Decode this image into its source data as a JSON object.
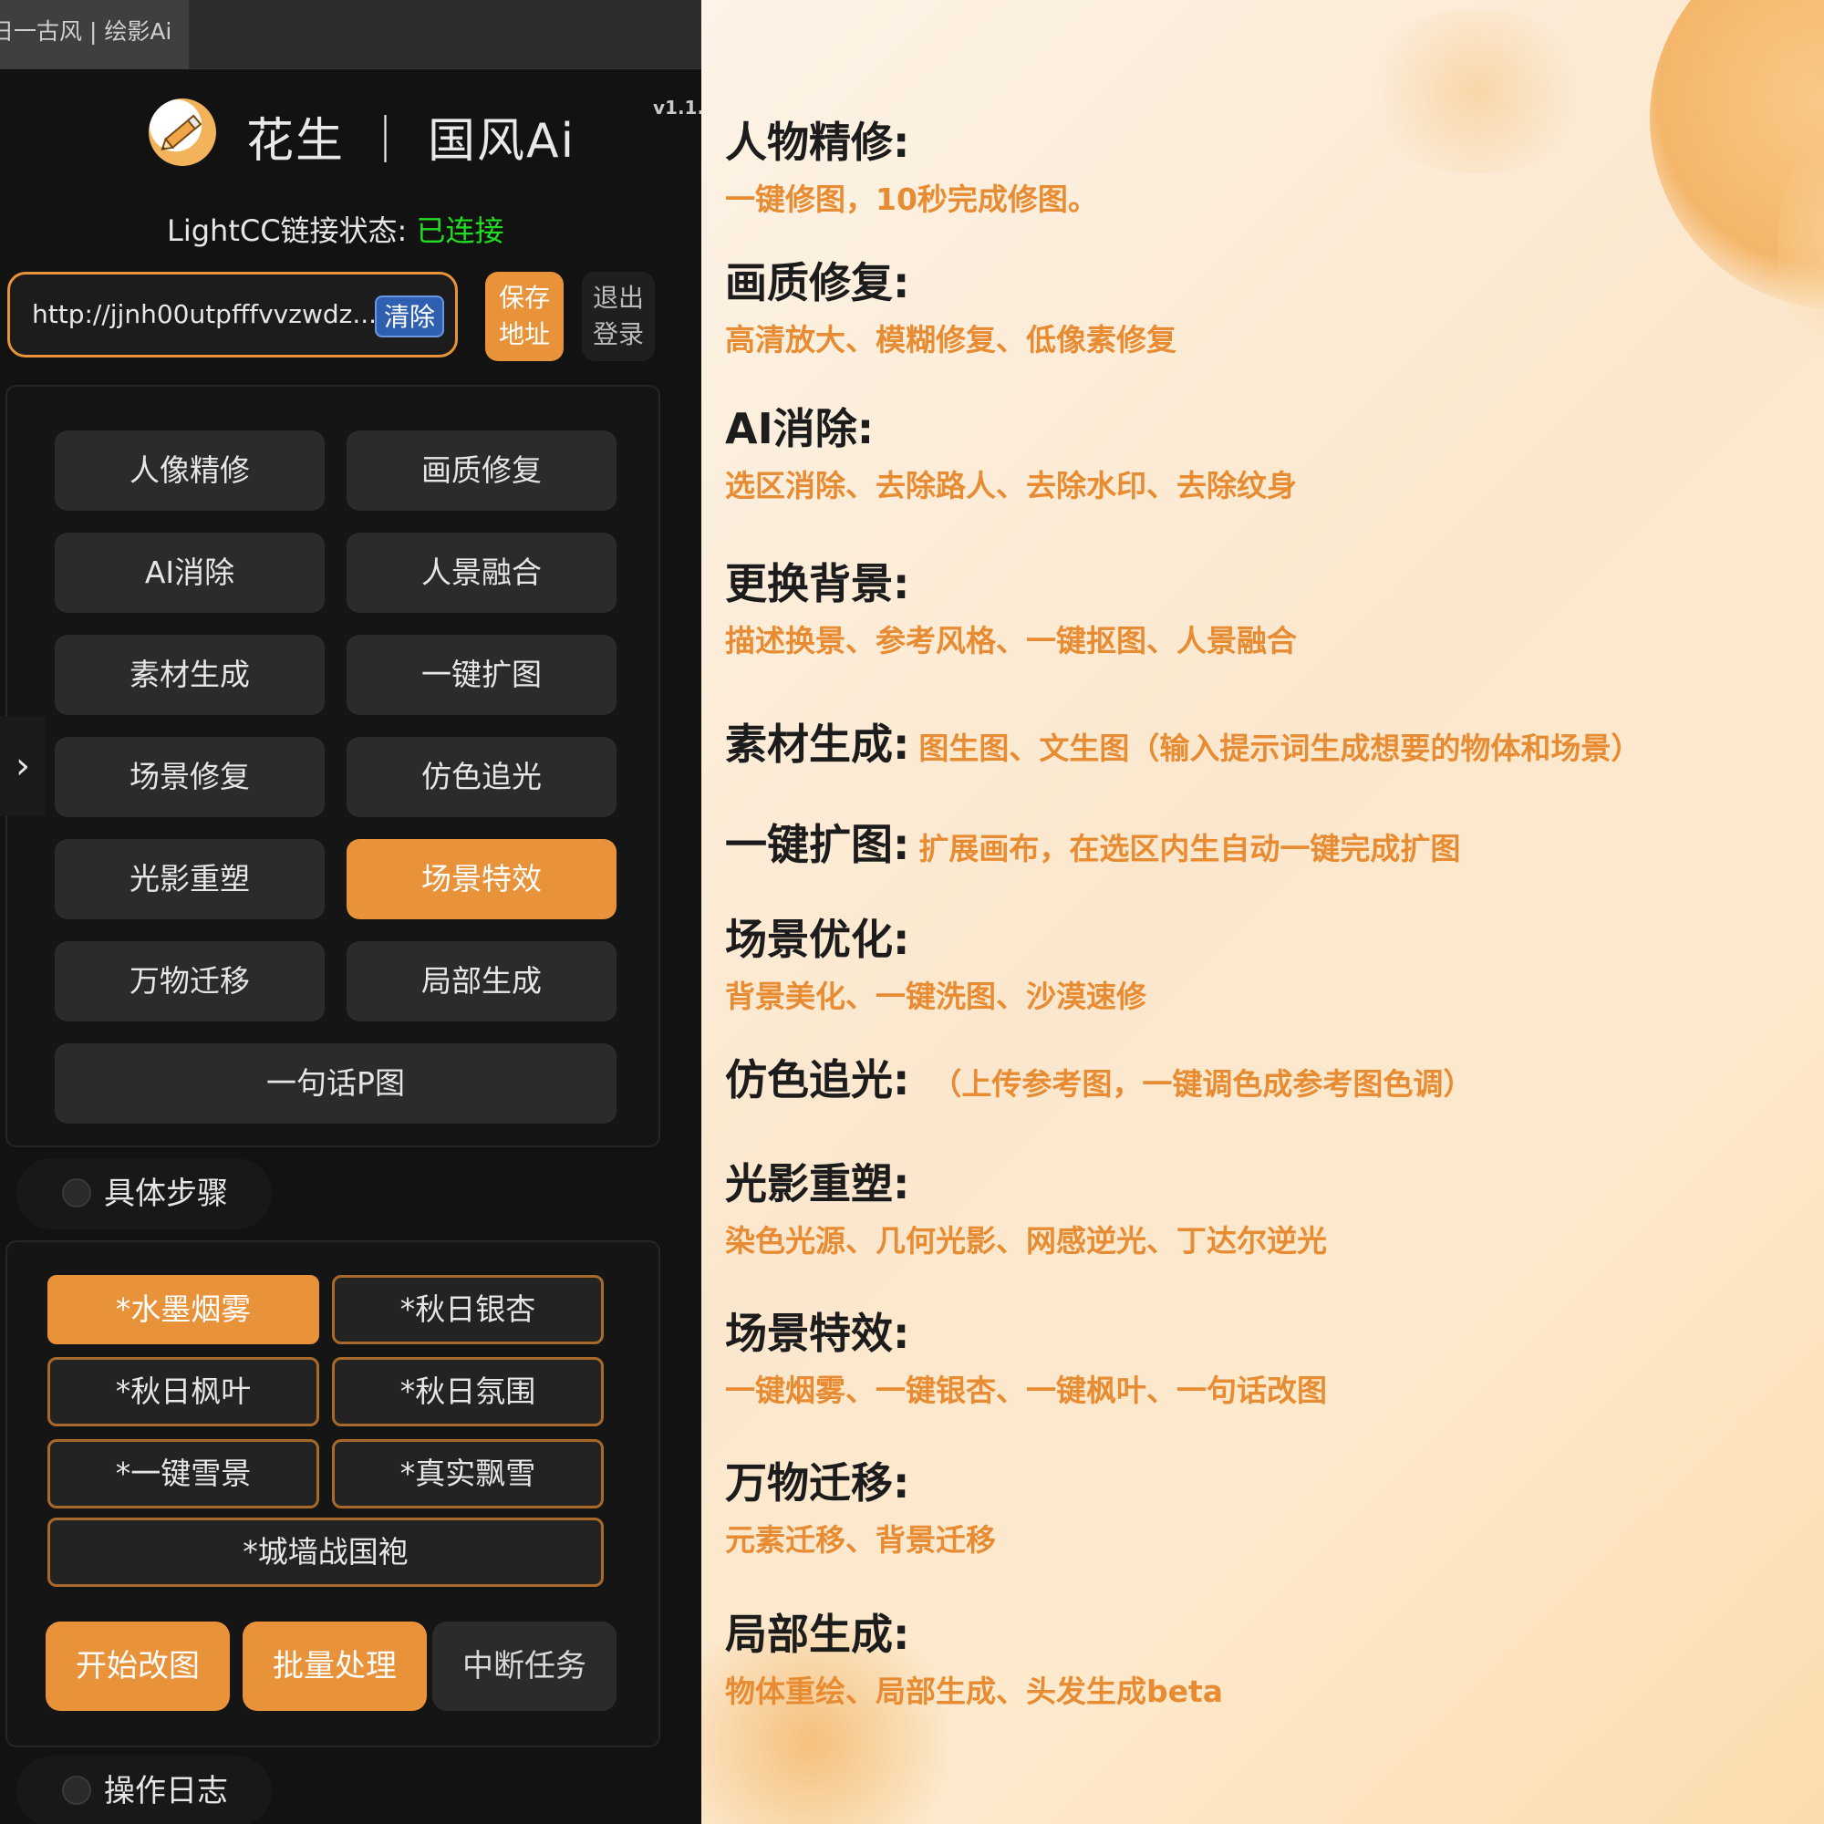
{
  "window": {
    "tab_title": "日一古风 | 绘影Ai"
  },
  "header": {
    "title": "花生 ｜ 国风Ai",
    "version": "v1.1."
  },
  "connection": {
    "label": "LightCC链接状态:",
    "value": "已连接",
    "value_color": "#22dd22"
  },
  "address": {
    "url": "http://jjnh00utpfffvvzwdz...",
    "clear_label": "清除",
    "save_label": "保存地址",
    "logout_label": "退出登录"
  },
  "functions": [
    {
      "label": "人像精修",
      "active": false
    },
    {
      "label": "画质修复",
      "active": false
    },
    {
      "label": "AI消除",
      "active": false
    },
    {
      "label": "人景融合",
      "active": false
    },
    {
      "label": "素材生成",
      "active": false
    },
    {
      "label": "一键扩图",
      "active": false
    },
    {
      "label": "场景修复",
      "active": false
    },
    {
      "label": "仿色追光",
      "active": false
    },
    {
      "label": "光影重塑",
      "active": false
    },
    {
      "label": "场景特效",
      "active": true
    },
    {
      "label": "万物迁移",
      "active": false
    },
    {
      "label": "局部生成",
      "active": false
    },
    {
      "label": "一句话P图",
      "active": false
    }
  ],
  "side_arrow": "›",
  "steps_section": {
    "label": "具体步骤"
  },
  "effects": [
    {
      "label": "*水墨烟雾",
      "active": true
    },
    {
      "label": "*秋日银杏",
      "active": false
    },
    {
      "label": "*秋日枫叶",
      "active": false
    },
    {
      "label": "*秋日氛围",
      "active": false
    },
    {
      "label": "*一键雪景",
      "active": false
    },
    {
      "label": "*真实飘雪",
      "active": false
    },
    {
      "label": "*城墙战国袍",
      "active": false
    }
  ],
  "actions": {
    "start": "开始改图",
    "batch": "批量处理",
    "stop": "中断任务"
  },
  "log_section": {
    "label": "操作日志"
  },
  "features": [
    {
      "title": "人物精修:",
      "desc": "一键修图，10秒完成修图。"
    },
    {
      "title": "画质修复:",
      "desc": "高清放大、模糊修复、低像素修复"
    },
    {
      "title": "AI消除:",
      "desc": "选区消除、去除路人、去除水印、去除纹身"
    },
    {
      "title": "更换背景:",
      "desc": "描述换景、参考风格、一键抠图、人景融合"
    },
    {
      "title": "素材生成:",
      "desc": "图生图、文生图（输入提示词生成想要的物体和场景）"
    },
    {
      "title": "一键扩图:",
      "desc": "扩展画布，在选区内生自动一键完成扩图"
    },
    {
      "title": "场景优化:",
      "desc": "背景美化、一键洗图、沙漠速修"
    },
    {
      "title": "仿色追光:",
      "desc": "（上传参考图，一键调色成参考图色调）"
    },
    {
      "title": "光影重塑:",
      "desc": "染色光源、几何光影、网感逆光、丁达尔逆光"
    },
    {
      "title": "场景特效:",
      "desc": "一键烟雾、一键银杏、一键枫叶、一句话改图"
    },
    {
      "title": "万物迁移:",
      "desc": "元素迁移、背景迁移"
    },
    {
      "title": "局部生成:",
      "desc": "物体重绘、局部生成、头发生成beta"
    }
  ],
  "colors": {
    "accent": "#e8923a",
    "panel_bg": "#121212",
    "button_bg": "#2b2b2b",
    "feature_desc": "#e88c33"
  },
  "icons": {
    "logo": "pencil-circle-icon",
    "arrow": "chevron-right-icon",
    "section": "collapse-dot-icon"
  }
}
